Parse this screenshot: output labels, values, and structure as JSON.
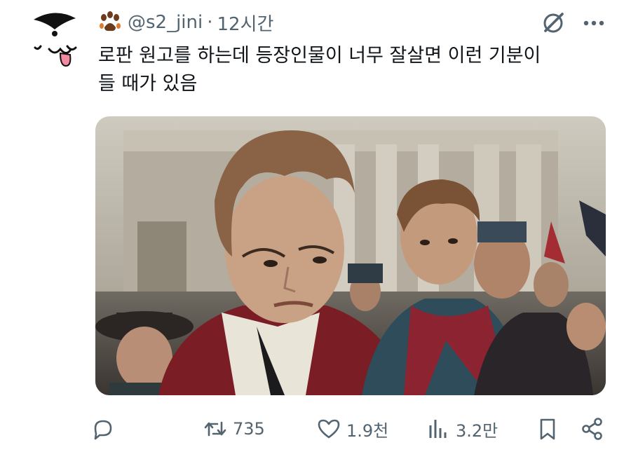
{
  "user": {
    "handle": "@s2_jini",
    "separator": "·",
    "time": "12시간"
  },
  "tweet": {
    "line1": "로판 원고를 하는데 등장인물이 너무 잘살면 이런 기분이",
    "line2": "들 때가 있음"
  },
  "actions": {
    "reply_icon": "reply-icon",
    "retweet_icon": "retweet-icon",
    "retweet_count": "735",
    "like_icon": "heart-icon",
    "like_count": "1.9천",
    "views_icon": "views-icon",
    "views_count": "3.2만",
    "bookmark_icon": "bookmark-icon",
    "share_icon": "share-icon"
  },
  "colors": {
    "text": "#0f1419",
    "secondary": "#536471"
  }
}
